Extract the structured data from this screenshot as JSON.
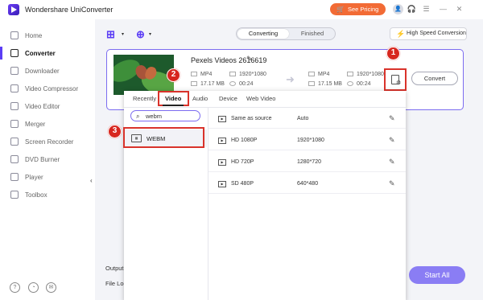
{
  "app": {
    "title": "Wondershare UniConverter",
    "pricing_label": "See Pricing"
  },
  "sidebar": {
    "items": [
      {
        "label": "Home",
        "icon": "home-icon",
        "active": false
      },
      {
        "label": "Converter",
        "icon": "converter-icon",
        "active": true
      },
      {
        "label": "Downloader",
        "icon": "downloader-icon",
        "active": false
      },
      {
        "label": "Video Compressor",
        "icon": "compress-icon",
        "active": false
      },
      {
        "label": "Video Editor",
        "icon": "scissors-icon",
        "active": false
      },
      {
        "label": "Merger",
        "icon": "merge-icon",
        "active": false
      },
      {
        "label": "Screen Recorder",
        "icon": "record-icon",
        "active": false
      },
      {
        "label": "DVD Burner",
        "icon": "disc-icon",
        "active": false
      },
      {
        "label": "Player",
        "icon": "play-icon",
        "active": false
      },
      {
        "label": "Toolbox",
        "icon": "grid-icon",
        "active": false
      }
    ]
  },
  "toolbar": {
    "tab_converting": "Converting",
    "tab_finished": "Finished",
    "high_speed_label": "High Speed Conversion"
  },
  "file": {
    "name": "Pexels Videos 2616619",
    "source": {
      "format": "MP4",
      "resolution": "1920*1080",
      "size": "17.17 MB",
      "duration": "00:24"
    },
    "target": {
      "format": "MP4",
      "resolution": "1920*1080",
      "size": "17.15 MB",
      "duration": "00:24"
    },
    "convert_label": "Convert"
  },
  "badges": {
    "one": "1",
    "two": "2",
    "three": "3"
  },
  "format_popup": {
    "tabs": [
      "Recently",
      "Video",
      "Audio",
      "Device",
      "Web Video"
    ],
    "selected_tab": "Video",
    "search_value": "webm",
    "formats": [
      {
        "label": "WEBM",
        "icon": "webm-format-icon"
      }
    ],
    "presets": [
      {
        "name": "Same as source",
        "resolution": "Auto"
      },
      {
        "name": "HD 1080P",
        "resolution": "1920*1080"
      },
      {
        "name": "HD 720P",
        "resolution": "1280*720"
      },
      {
        "name": "SD 480P",
        "resolution": "640*480"
      }
    ]
  },
  "bottom": {
    "output_label": "Output",
    "file_location_label": "File Location:",
    "start_all_label": "Start All"
  },
  "colors": {
    "accent": "#5b3df5",
    "pricing": "#f26b35",
    "highlight": "#d9332b",
    "start_all": "#8a7df4"
  }
}
